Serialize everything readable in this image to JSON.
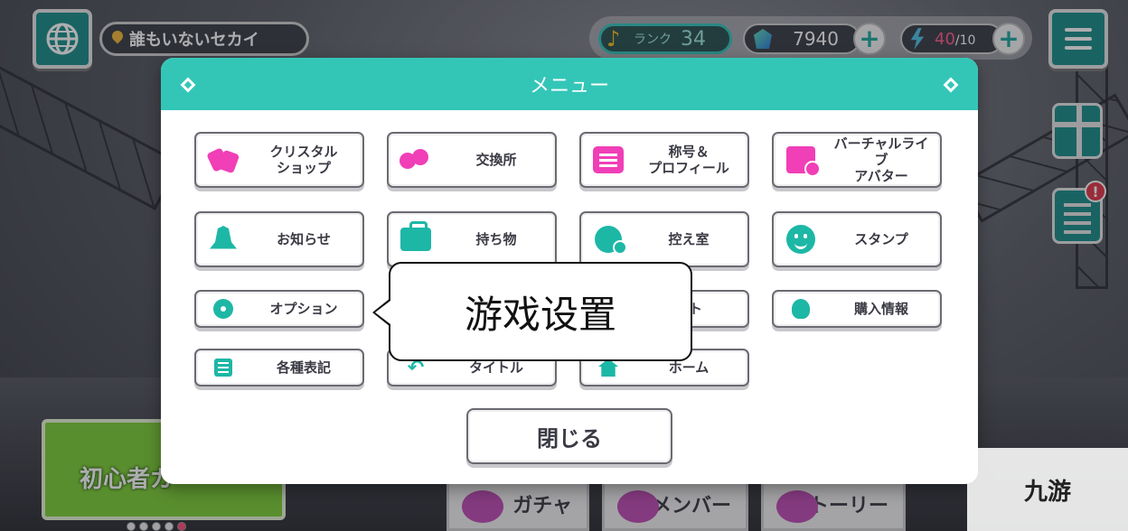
{
  "topbar": {
    "location": "誰もいないセカイ",
    "rank_label": "ランク",
    "rank_value": "34",
    "gems": "7940",
    "energy_current": "40",
    "energy_max": "/10"
  },
  "menu": {
    "title": "メニュー",
    "items": [
      {
        "label": "クリスタル\nショップ",
        "icon": "crystal-icon"
      },
      {
        "label": "交換所",
        "icon": "coins-icon"
      },
      {
        "label": "称号＆\nプロフィール",
        "icon": "profile-card-icon"
      },
      {
        "label": "バーチャルライブ\nアバター",
        "icon": "avatar-icon"
      },
      {
        "label": "お知らせ",
        "icon": "bell-icon"
      },
      {
        "label": "持ち物",
        "icon": "bag-icon"
      },
      {
        "label": "控え室",
        "icon": "waiting-room-icon"
      },
      {
        "label": "スタンプ",
        "icon": "smile-icon"
      },
      {
        "label": "オプション",
        "icon": "gear-icon"
      },
      {
        "label": "ート",
        "icon": ""
      },
      {
        "label": "購入情報",
        "icon": "bulb-icon"
      },
      {
        "label": "各種表記",
        "icon": "list-icon"
      },
      {
        "label": "タイトル",
        "icon": "back-arrow-icon"
      },
      {
        "label": "ホーム",
        "icon": "home-icon"
      }
    ],
    "close_label": "閉じる"
  },
  "tooltip": {
    "text": "游戏设置"
  },
  "background": {
    "beginner_banner": "初心者ガ",
    "nav": [
      "ガチャ",
      "メンバー",
      "ストーリー"
    ]
  },
  "watermark": "九游",
  "colors": {
    "accent": "#33c6b7",
    "icon_pink": "#f03fb7",
    "icon_teal": "#1db7a6",
    "energy": "#ff5d8f"
  }
}
